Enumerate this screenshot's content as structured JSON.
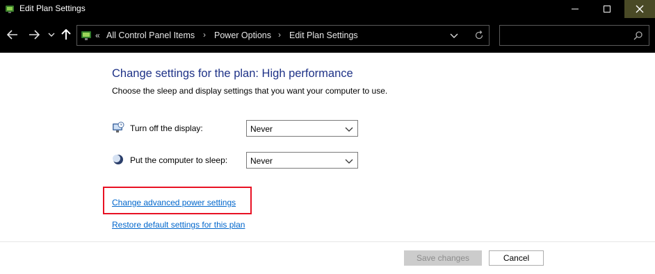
{
  "window": {
    "title": "Edit Plan Settings",
    "minimize_glyph": "—",
    "maximize_glyph": "☐",
    "close_glyph": "✕"
  },
  "nav": {
    "back_icon": "back-arrow-icon",
    "forward_icon": "forward-arrow-icon",
    "recent_icon": "chevron-down-icon",
    "up_icon": "up-arrow-icon"
  },
  "address": {
    "overflow": "«",
    "crumbs": [
      "All Control Panel Items",
      "Power Options",
      "Edit Plan Settings"
    ],
    "separator": "›"
  },
  "search": {
    "placeholder": "",
    "value": ""
  },
  "main": {
    "heading": "Change settings for the plan: High performance",
    "subheading": "Choose the sleep and display settings that you want your computer to use.",
    "settings": [
      {
        "label": "Turn off the display:",
        "value": "Never",
        "icon": "monitor-icon"
      },
      {
        "label": "Put the computer to sleep:",
        "value": "Never",
        "icon": "moon-icon"
      }
    ],
    "links": {
      "advanced": "Change advanced power settings",
      "restore": "Restore default settings for this plan"
    }
  },
  "footer": {
    "save_label": "Save changes",
    "cancel_label": "Cancel"
  },
  "colors": {
    "heading": "#1e3287",
    "link": "#0066cc",
    "highlight": "#e81123",
    "titlebar": "#000000"
  }
}
